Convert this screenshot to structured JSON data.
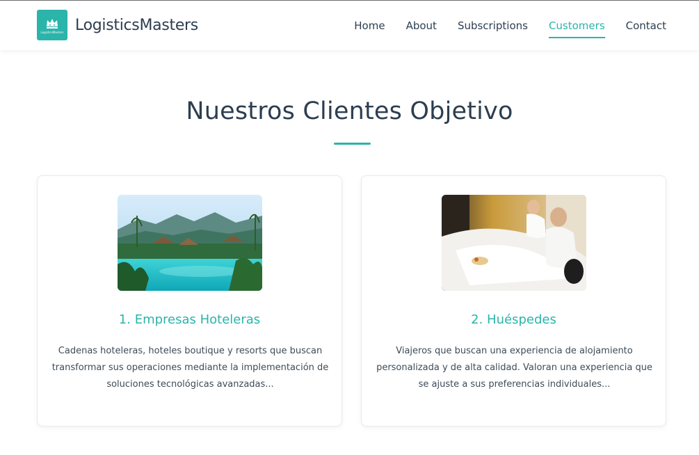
{
  "brand": {
    "name": "LogisticsMasters",
    "logo_text": "LogisticsMasters"
  },
  "nav": {
    "items": [
      {
        "label": "Home"
      },
      {
        "label": "About"
      },
      {
        "label": "Subscriptions"
      },
      {
        "label": "Customers"
      },
      {
        "label": "Contact"
      }
    ],
    "active": "Customers"
  },
  "section": {
    "title": "Nuestros Clientes Objetivo"
  },
  "cards": [
    {
      "title": "1. Empresas Hoteleras",
      "text": "Cadenas hoteleras, hoteles boutique y resorts que buscan transformar sus operaciones mediante la implementación de soluciones tecnológicas avanzadas...",
      "image_alt": "resort-pool-photo"
    },
    {
      "title": "2. Huéspedes",
      "text": "Viajeros que buscan una experiencia de alojamiento personalizada y de alta calidad. Valoran una experiencia que se ajuste a sus preferencias individuales...",
      "image_alt": "guests-in-bed-photo"
    }
  ],
  "colors": {
    "accent": "#2ab4aa",
    "heading": "#2c3e50"
  }
}
